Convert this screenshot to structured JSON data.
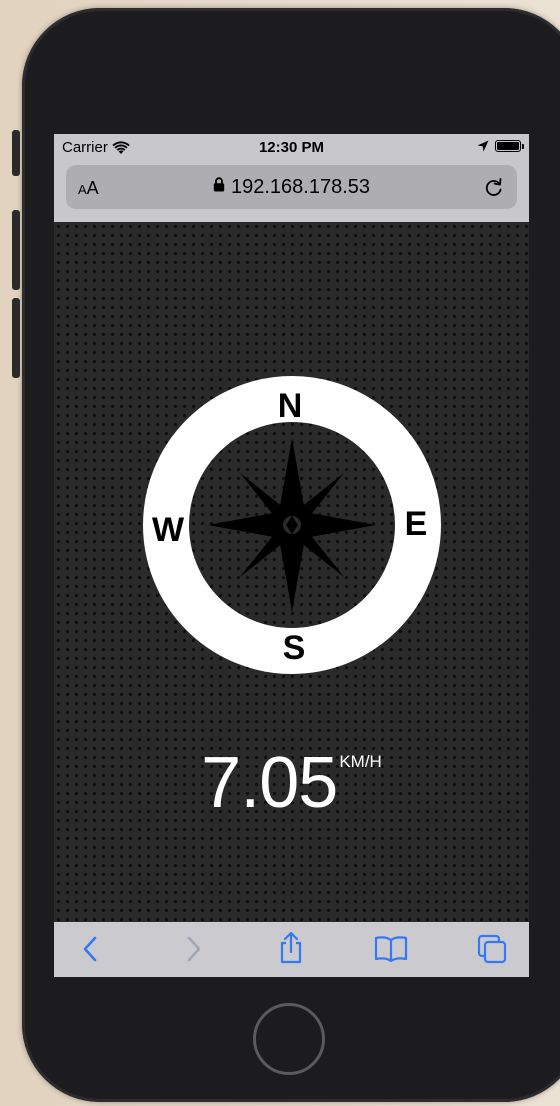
{
  "status_bar": {
    "carrier": "Carrier",
    "time": "12:30 PM",
    "icons": [
      "wifi-icon",
      "location-arrow-icon",
      "battery-icon"
    ]
  },
  "address_bar": {
    "text_size_button": "AA",
    "url": "192.168.178.53",
    "icons": [
      "lock-icon",
      "reload-icon"
    ]
  },
  "compass": {
    "north_label": "N",
    "east_label": "E",
    "south_label": "S",
    "west_label": "W",
    "ring_color": "#ffffff",
    "rose_color": "#000000"
  },
  "speed": {
    "value": "7.05",
    "unit": "KM/H"
  },
  "toolbar": {
    "buttons": [
      "back-icon",
      "forward-icon",
      "share-icon",
      "bookmarks-icon",
      "tabs-icon"
    ],
    "accent_color": "#3478f6",
    "disabled_color": "#9da7b8"
  },
  "colors": {
    "page_background": "#2a2a2a",
    "dot_color": "#0e0e0e",
    "speed_text": "#ffffff"
  }
}
